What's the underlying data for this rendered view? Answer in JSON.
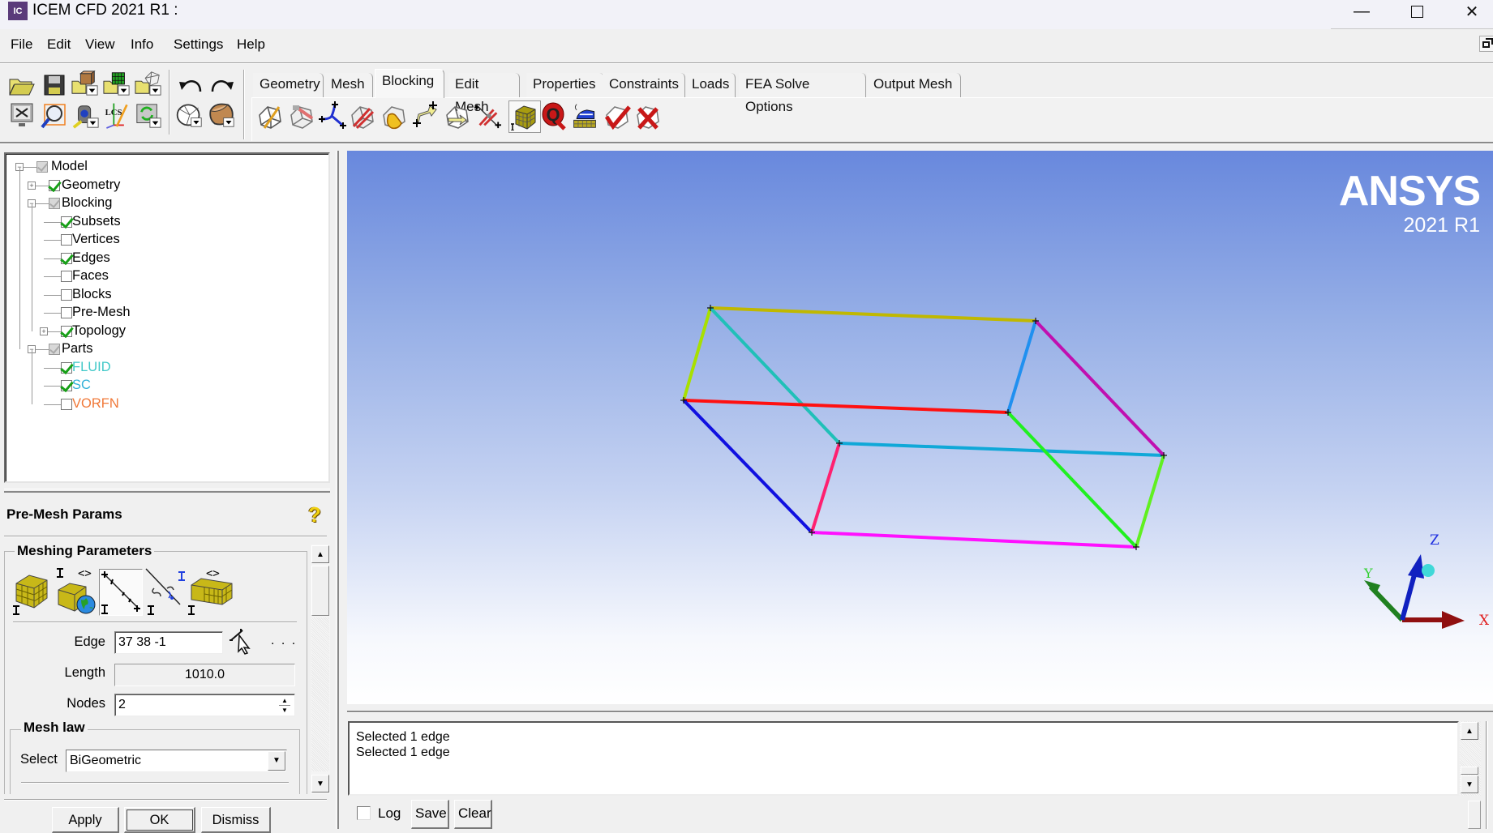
{
  "window": {
    "title": "ICEM CFD 2021 R1 :",
    "logo_text": "IC",
    "minimize_glyph": "—",
    "maximize_glyph": "☐",
    "close_glyph": "✕"
  },
  "menu": {
    "items": [
      "File",
      "Edit",
      "View",
      "Info",
      "Settings",
      "Help"
    ]
  },
  "toolbar": {
    "row1_icons": [
      "open-folder-icon",
      "save-disk-icon",
      "open-geometry-icon",
      "open-mesh-icon",
      "open-blocking-icon",
      "undo-icon",
      "redo-icon"
    ],
    "row2_icons": [
      "fit-window-icon",
      "zoom-box-icon",
      "measure-icon",
      "local-coord-system-icon",
      "refresh-icon",
      "wireframe-display-icon",
      "solid-display-icon"
    ],
    "lcs_label": "LCS"
  },
  "tabs": {
    "items": [
      "Geometry",
      "Mesh",
      "Blocking",
      "Edit Mesh",
      "Properties",
      "Constraints",
      "Loads",
      "FEA Solve Options",
      "Output Mesh"
    ],
    "active": "Blocking",
    "blocking_tools": [
      "create-block-icon",
      "split-block-icon",
      "merge-vertices-icon",
      "edit-block-icon",
      "associate-icon",
      "move-vertex-icon",
      "transform-blocks-icon",
      "edit-edge-icon",
      "pre-mesh-params-icon",
      "pre-mesh-quality-icon",
      "pre-mesh-smooth-icon",
      "check-blocks-icon",
      "delete-block-icon"
    ],
    "quality_glyph": "Q"
  },
  "tree": {
    "items": [
      {
        "label": "Model",
        "level": 0,
        "expander": "−",
        "check": "grey",
        "color": "#000000"
      },
      {
        "label": "Geometry",
        "level": 1,
        "expander": "+",
        "check": "checked",
        "color": "#000000"
      },
      {
        "label": "Blocking",
        "level": 1,
        "expander": "−",
        "check": "grey",
        "color": "#000000"
      },
      {
        "label": "Subsets",
        "level": 2,
        "expander": "",
        "check": "checked",
        "color": "#000000"
      },
      {
        "label": "Vertices",
        "level": 2,
        "expander": "",
        "check": "unchecked",
        "color": "#000000"
      },
      {
        "label": "Edges",
        "level": 2,
        "expander": "",
        "check": "checked",
        "color": "#000000"
      },
      {
        "label": "Faces",
        "level": 2,
        "expander": "",
        "check": "unchecked",
        "color": "#000000"
      },
      {
        "label": "Blocks",
        "level": 2,
        "expander": "",
        "check": "unchecked",
        "color": "#000000"
      },
      {
        "label": "Pre-Mesh",
        "level": 2,
        "expander": "",
        "check": "unchecked",
        "color": "#000000"
      },
      {
        "label": "Topology",
        "level": 2,
        "expander": "+",
        "check": "checked",
        "color": "#000000"
      },
      {
        "label": "Parts",
        "level": 1,
        "expander": "−",
        "check": "grey",
        "color": "#000000"
      },
      {
        "label": "FLUID",
        "level": 2,
        "expander": "",
        "check": "checked",
        "color": "#40c8c8"
      },
      {
        "label": "SC",
        "level": 2,
        "expander": "",
        "check": "checked",
        "color": "#30b0d8"
      },
      {
        "label": "VORFN",
        "level": 2,
        "expander": "",
        "check": "unchecked",
        "color": "#f07838"
      }
    ]
  },
  "premesh": {
    "title": "Pre-Mesh Params",
    "help_glyph": "?",
    "group_label": "Meshing Parameters",
    "param_icons": [
      "update-all-icon",
      "scale-sizes-icon",
      "edge-params-icon",
      "match-edges-icon",
      "define-block-params-icon"
    ],
    "selected_param_icon": "edge-params-icon",
    "edge_label": "Edge",
    "edge_value": "37 38 -1",
    "edge_more": ". . .",
    "length_label": "Length",
    "length_value": "1010.0",
    "nodes_label": "Nodes",
    "nodes_value": "2",
    "meshlaw_label": "Mesh law",
    "select_label": "Select",
    "select_value": "BiGeometric",
    "apply_label": "Apply",
    "ok_label": "OK",
    "dismiss_label": "Dismiss"
  },
  "viewport": {
    "brand": "ANSYS",
    "version": "2021 R1",
    "axes": {
      "x_label": "X",
      "y_label": "Y",
      "z_label": "Z",
      "x_color": "#a01010",
      "y_color": "#209020",
      "z_color": "#1020c0"
    },
    "edges": [
      {
        "name": "edge-top-back",
        "color": "#c0b800"
      },
      {
        "name": "edge-left-upright",
        "color": "#a8e000"
      },
      {
        "name": "edge-diagonal-left",
        "color": "#20c0b8"
      },
      {
        "name": "edge-middle-red",
        "color": "#ff1010"
      },
      {
        "name": "edge-left-bottom",
        "color": "#1010e0"
      },
      {
        "name": "edge-front-upright",
        "color": "#ff2070"
      },
      {
        "name": "edge-front-top",
        "color": "#10a8d8"
      },
      {
        "name": "edge-bottom-front",
        "color": "#ff10ff"
      },
      {
        "name": "edge-right-back-upright",
        "color": "#2090f0"
      },
      {
        "name": "edge-right-diagonal-top",
        "color": "#c010b0"
      },
      {
        "name": "edge-right-diagonal-bottom",
        "color": "#20f020"
      },
      {
        "name": "edge-right-front-upright",
        "color": "#60f020"
      }
    ]
  },
  "messages": {
    "lines": [
      "Selected 1 edge",
      "Selected 1 edge"
    ],
    "log_label": "Log",
    "log_checked": false,
    "save_label": "Save",
    "clear_label": "Clear"
  }
}
